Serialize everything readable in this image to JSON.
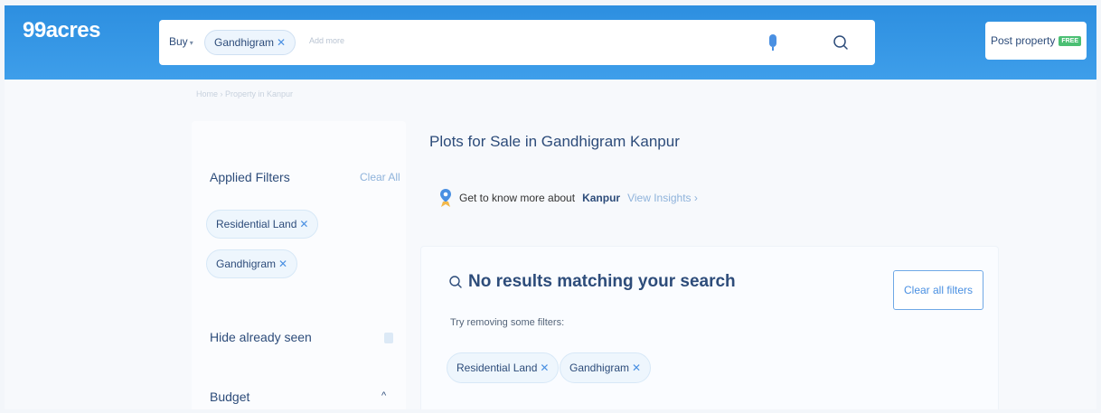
{
  "header": {
    "logo": "99acres",
    "search": {
      "buy_label": "Buy",
      "location_chip": "Gandhigram",
      "placeholder": "Add more"
    },
    "post_property": {
      "label": "Post property",
      "badge": "FREE"
    }
  },
  "breadcrumb": "Home › Property in Kanpur",
  "sidebar": {
    "applied_filters_title": "Applied Filters",
    "clear_all_label": "Clear All",
    "applied_filters": [
      "Residential Land",
      "Gandhigram"
    ],
    "hide_seen_label": "Hide already seen",
    "budget_label": "Budget"
  },
  "main": {
    "title": "Plots for Sale in Gandhigram Kanpur",
    "insights": {
      "prefix": "Get to know more about",
      "city": "Kanpur",
      "link": "View Insights"
    },
    "no_results": {
      "heading": "No results matching your search",
      "subtitle": "Try removing some filters:",
      "chips": [
        "Residential Land",
        "Gandhigram"
      ],
      "clear_button": "Clear all filters"
    }
  },
  "colors": {
    "brand_blue": "#2d8fe0",
    "text_navy": "#2d4c7a",
    "free_green": "#4bbf73"
  }
}
